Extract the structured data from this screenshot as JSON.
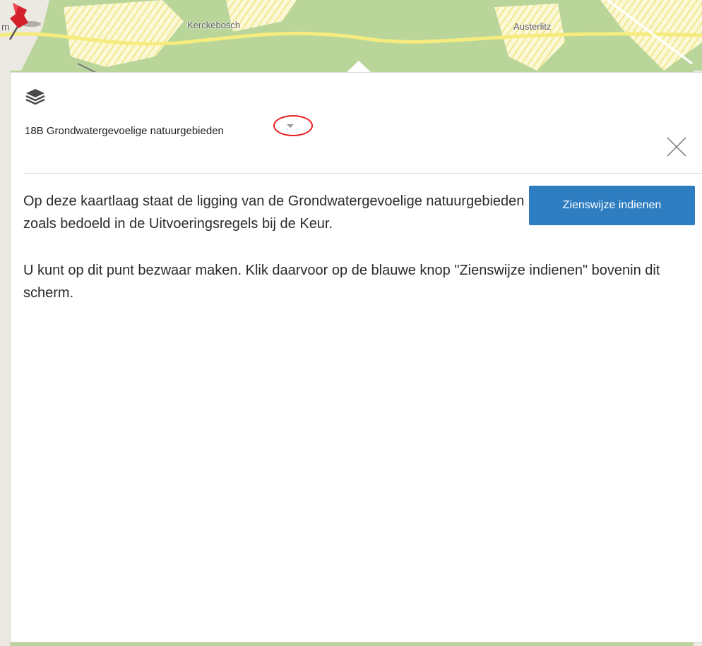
{
  "map": {
    "labels": [
      "Kerckebosch",
      "Austerlitz"
    ],
    "edge_label_left": "m",
    "pin_icon": "red-pushpin"
  },
  "popup": {
    "layers_icon": "layers-stack-icon",
    "layer_name": "18B Grondwatergevoelige natuurgebieden",
    "close_icon": "close-x-icon",
    "action_button_label": "Zienswijze indienen",
    "description_1": "Op deze kaartlaag staat de ligging van de Grondwatergevoelige natuurgebieden zoals bedoeld in de Uitvoeringsregels bij de Keur.",
    "description_2": "U kunt op dit punt bezwaar maken. Klik daarvoor op de blauwe knop \"Zienswijze indienen\" bovenin dit scherm."
  },
  "colors": {
    "button_blue": "#2f7dc1",
    "map_green": "#b9d59a",
    "map_road_yellow": "#f5ec7d",
    "annotation_red": "#e51d1d"
  }
}
